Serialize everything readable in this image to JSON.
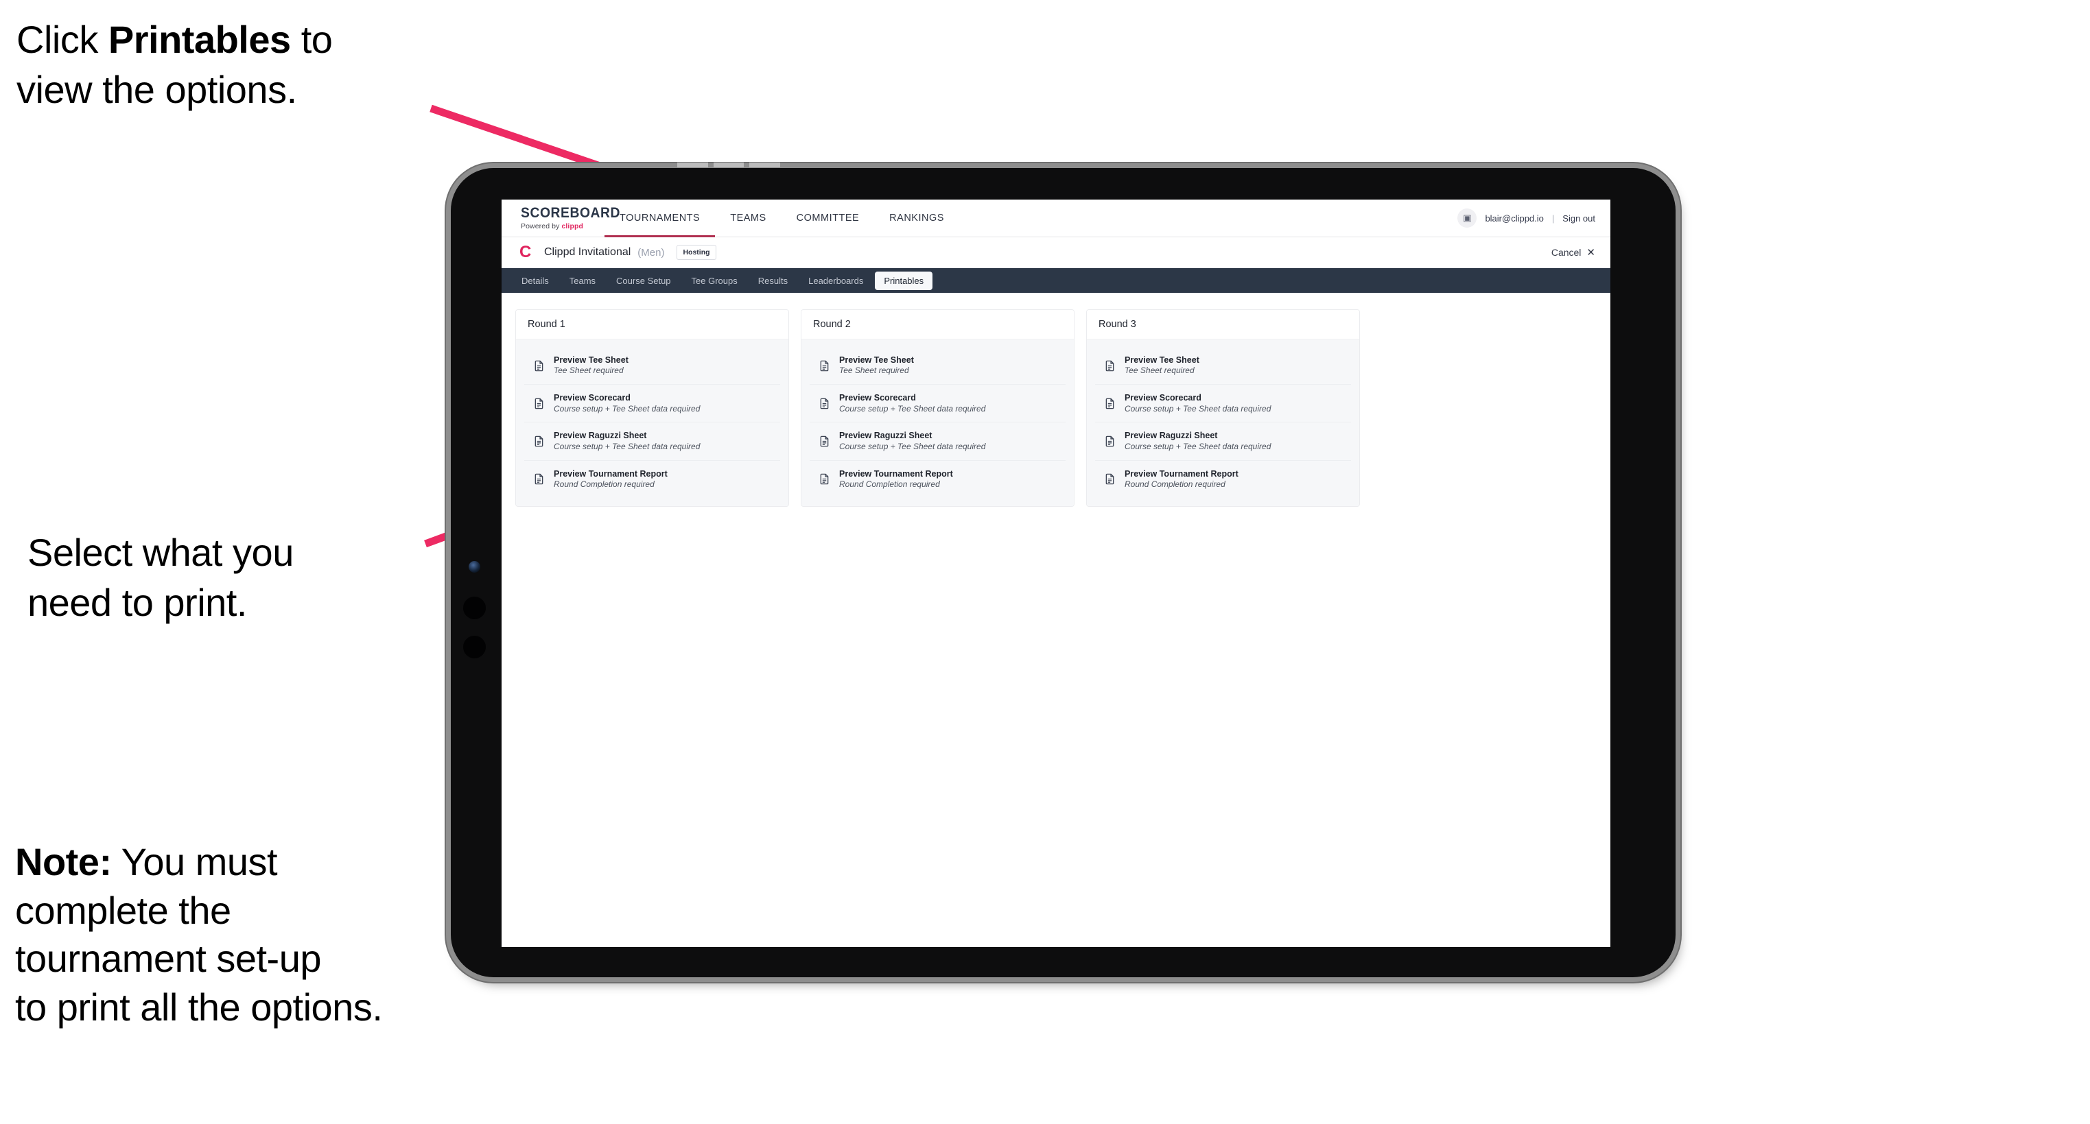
{
  "annotations": {
    "click_printables": {
      "prefix": "Click ",
      "bold": "Printables",
      "suffix": " to\nview the options."
    },
    "select_print": "Select what you\n need to print.",
    "note": {
      "bold": "Note:",
      "rest": " You must\ncomplete the\ntournament set-up\nto print all the options."
    }
  },
  "colors": {
    "accent_pink": "#ed2a63",
    "brand_red": "#e0245e",
    "tab_bar_dark": "#2c3747",
    "nav_underline": "#b03050"
  },
  "global_nav": {
    "brand_title": "SCOREBOARD",
    "brand_sub_prefix": "Powered by ",
    "brand_sub_name": "clippd",
    "links": [
      {
        "label": "TOURNAMENTS",
        "active": true
      },
      {
        "label": "TEAMS",
        "active": false
      },
      {
        "label": "COMMITTEE",
        "active": false
      },
      {
        "label": "RANKINGS",
        "active": false
      }
    ],
    "avatar_glyph": "▣",
    "user_email": "blair@clippd.io",
    "separator": "|",
    "sign_out": "Sign out"
  },
  "tournament_bar": {
    "logo_glyph": "C",
    "name": "Clippd Invitational",
    "gender": "(Men)",
    "badge": "Hosting",
    "cancel_label": "Cancel",
    "cancel_icon": "✕"
  },
  "tabs": [
    {
      "label": "Details",
      "active": false
    },
    {
      "label": "Teams",
      "active": false
    },
    {
      "label": "Course Setup",
      "active": false
    },
    {
      "label": "Tee Groups",
      "active": false
    },
    {
      "label": "Results",
      "active": false
    },
    {
      "label": "Leaderboards",
      "active": false
    },
    {
      "label": "Printables",
      "active": true
    }
  ],
  "rounds": [
    {
      "heading": "Round 1",
      "items": [
        {
          "title": "Preview Tee Sheet",
          "subtitle": "Tee Sheet required"
        },
        {
          "title": "Preview Scorecard",
          "subtitle": "Course setup + Tee Sheet data required"
        },
        {
          "title": "Preview Raguzzi Sheet",
          "subtitle": "Course setup + Tee Sheet data required"
        },
        {
          "title": "Preview Tournament Report",
          "subtitle": "Round Completion required"
        }
      ]
    },
    {
      "heading": "Round 2",
      "items": [
        {
          "title": "Preview Tee Sheet",
          "subtitle": "Tee Sheet required"
        },
        {
          "title": "Preview Scorecard",
          "subtitle": "Course setup + Tee Sheet data required"
        },
        {
          "title": "Preview Raguzzi Sheet",
          "subtitle": "Course setup + Tee Sheet data required"
        },
        {
          "title": "Preview Tournament Report",
          "subtitle": "Round Completion required"
        }
      ]
    },
    {
      "heading": "Round 3",
      "items": [
        {
          "title": "Preview Tee Sheet",
          "subtitle": "Tee Sheet required"
        },
        {
          "title": "Preview Scorecard",
          "subtitle": "Course setup + Tee Sheet data required"
        },
        {
          "title": "Preview Raguzzi Sheet",
          "subtitle": "Course setup + Tee Sheet data required"
        },
        {
          "title": "Preview Tournament Report",
          "subtitle": "Round Completion required"
        }
      ]
    }
  ]
}
